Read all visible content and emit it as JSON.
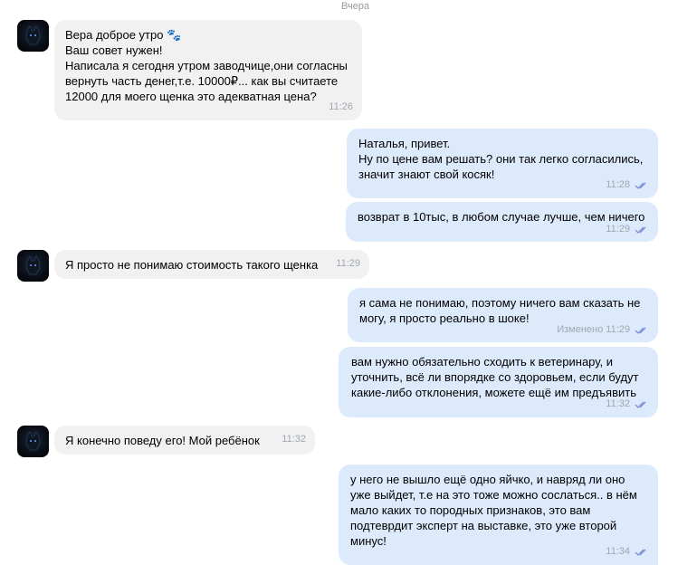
{
  "date_separator": "Вчера",
  "messages": [
    {
      "text": "Вера доброе утро 🐾\nВаш совет нужен!\nНаписала я сегодня утром заводчице,они согласны\nвернуть часть денег,т.е. 10000₽... как вы считаете\n12000 для моего щенка это адекватная цена?",
      "time": "11:26"
    },
    {
      "text": "Наталья, привет.\nНу по цене вам решать? они так легко согласились,\nзначит знают свой косяк!",
      "time": "11:28"
    },
    {
      "text": "возврат в 10тыс, в любом случае лучше, чем ничего",
      "time": "11:29"
    },
    {
      "text": "Я просто не понимаю стоимость такого щенка",
      "time": "11:29"
    },
    {
      "text": "я сама не понимаю, поэтому ничего вам сказать не\nмогу, я просто реально в шоке!",
      "time": "Изменено 11:29"
    },
    {
      "text": "вам нужно обязательно сходить к ветеринару, и\nуточнить, всё ли впорядке со здоровьем, если будут\nкакие-либо отклонения, можете ещё им предъявить",
      "time": "11:32"
    },
    {
      "text": "Я конечно поведу его! Мой ребёнок",
      "time": "11:32"
    },
    {
      "text": "у него не вышло ещё одно яйчко, и навряд ли оно\nуже выйдет, т.е на это тоже можно сослаться.. в нём\nмало каких то породных признаков, это вам\nподтеврдит эксперт на выставке, это уже второй\nминус!",
      "time": "11:34"
    }
  ],
  "status_icon": "double-check-icon",
  "colors": {
    "incoming": "#f1f1f1",
    "outgoing": "#dceafc",
    "check": "#7a8fd6",
    "time": "#a0a8b2"
  }
}
